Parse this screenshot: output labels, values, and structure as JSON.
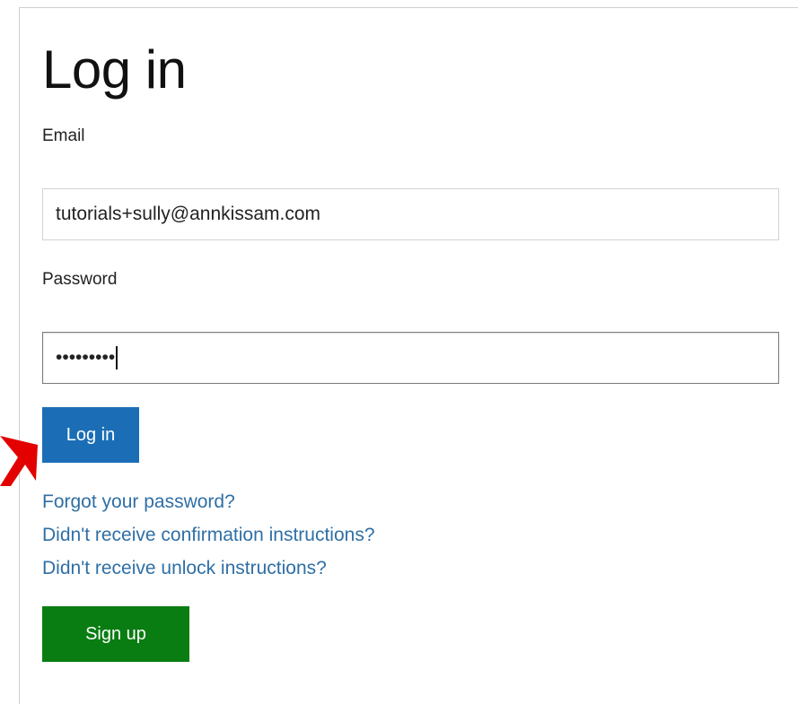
{
  "form": {
    "title": "Log in",
    "email_label": "Email",
    "email_value": "tutorials+sully@annkissam.com",
    "password_label": "Password",
    "password_mask": "•••••••••",
    "login_button": "Log in",
    "signup_button": "Sign up"
  },
  "links": {
    "forgot_password": "Forgot your password?",
    "confirmation": "Didn't receive confirmation instructions?",
    "unlock": "Didn't receive unlock instructions?"
  },
  "colors": {
    "login_button": "#1b6eb5",
    "signup_button": "#0a7d12",
    "link": "#2f6fa5",
    "pointer_arrow": "#e30000"
  },
  "icons": {
    "pointer": "red-arrow-pointer-icon"
  }
}
